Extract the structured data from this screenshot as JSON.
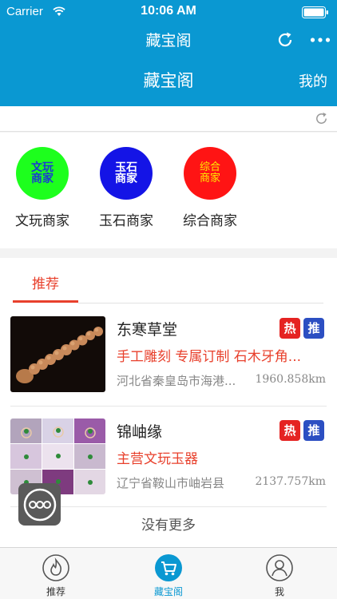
{
  "status_bar": {
    "carrier": "Carrier",
    "time": "10:06 AM"
  },
  "nav": {
    "title": "藏宝阁",
    "subtitle": "藏宝阁",
    "my_link": "我的"
  },
  "merchants": [
    {
      "circle_text": "文玩商家",
      "label": "文玩商家",
      "bg": "#1dff1d",
      "text_color": "#1a3bd0"
    },
    {
      "circle_text": "玉石商家",
      "label": "玉石商家",
      "bg": "#1414e6",
      "text_color": "#ffffff"
    },
    {
      "circle_text": "综合商家",
      "label": "综合商家",
      "bg": "#ff1414",
      "text_color": "#ffee00"
    }
  ],
  "recommend": {
    "tab": "推荐",
    "shops": [
      {
        "name": "东寒草堂",
        "badge_hot": "热",
        "badge_rec": "推",
        "desc": "手工雕刻 专属订制 石木牙角...",
        "location": "河北省秦皇岛市海港...",
        "distance": "1960.858km"
      },
      {
        "name": "锦岫缘",
        "badge_hot": "热",
        "badge_rec": "推",
        "desc": "主营文玩玉器",
        "location": "辽宁省鞍山市岫岩县",
        "distance": "2137.757km"
      }
    ],
    "no_more": "没有更多"
  },
  "tab_bar": [
    {
      "label": "推荐",
      "icon": "flame-icon",
      "active": false
    },
    {
      "label": "藏宝阁",
      "icon": "cart-icon",
      "active": true
    },
    {
      "label": "我",
      "icon": "person-icon",
      "active": false
    }
  ],
  "colors": {
    "brand_blue": "#0a98d2",
    "accent_red": "#e8402c",
    "badge_red": "#e52322",
    "badge_blue": "#2c4fc2"
  }
}
